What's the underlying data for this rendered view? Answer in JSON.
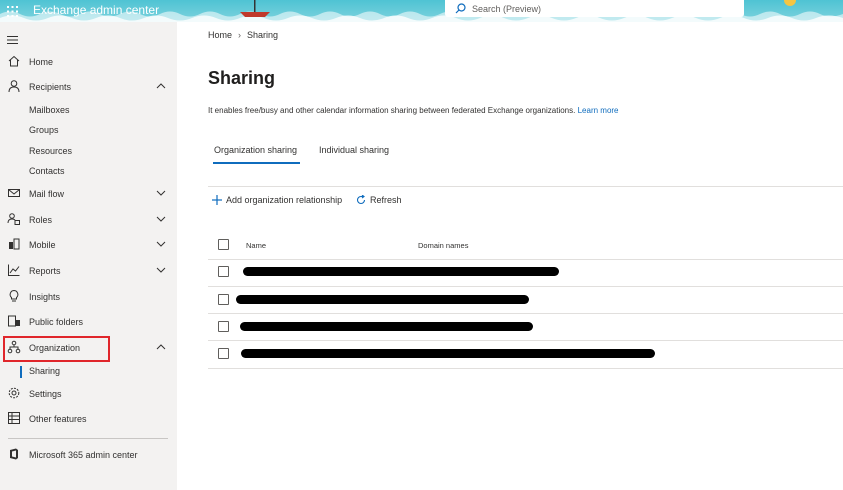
{
  "header": {
    "app_title": "Exchange admin center",
    "search_placeholder": "Search (Preview)",
    "icons": [
      "waffle-icon",
      "search-icon"
    ]
  },
  "sidebar": {
    "items": [
      {
        "label": "Home",
        "icon": "home-icon"
      },
      {
        "label": "Recipients",
        "icon": "person-icon",
        "expanded": true,
        "children": [
          "Mailboxes",
          "Groups",
          "Resources",
          "Contacts"
        ]
      },
      {
        "label": "Mail flow",
        "icon": "mail-icon",
        "expanded": false
      },
      {
        "label": "Roles",
        "icon": "roles-icon",
        "expanded": false
      },
      {
        "label": "Mobile",
        "icon": "mobile-icon",
        "expanded": false
      },
      {
        "label": "Reports",
        "icon": "chart-icon",
        "expanded": false
      },
      {
        "label": "Insights",
        "icon": "lightbulb-icon"
      },
      {
        "label": "Public folders",
        "icon": "folder-icon"
      },
      {
        "label": "Organization",
        "icon": "org-icon",
        "expanded": true,
        "children": [
          "Sharing"
        ]
      },
      {
        "label": "Settings",
        "icon": "gear-icon"
      },
      {
        "label": "Other features",
        "icon": "grid-icon"
      },
      {
        "label": "Microsoft 365 admin center",
        "icon": "office-icon"
      }
    ],
    "active_child": "Sharing",
    "highlight_color": "#e0262b"
  },
  "breadcrumb": {
    "home": "Home",
    "current": "Sharing"
  },
  "page": {
    "title": "Sharing",
    "description": "It enables free/busy and other calendar information sharing between federated Exchange organizations.",
    "learn_more": "Learn more"
  },
  "tabs": [
    {
      "label": "Organization sharing",
      "selected": true
    },
    {
      "label": "Individual sharing",
      "selected": false
    }
  ],
  "commands": {
    "add": "Add organization relationship",
    "refresh": "Refresh"
  },
  "table": {
    "columns": [
      "Name",
      "Domain names"
    ],
    "rows": 4,
    "cell_content": "redacted"
  },
  "colors": {
    "accent": "#0f6cbd",
    "header_bg": "#4fc3d3",
    "sidebar_bg": "#f3f2f1"
  }
}
